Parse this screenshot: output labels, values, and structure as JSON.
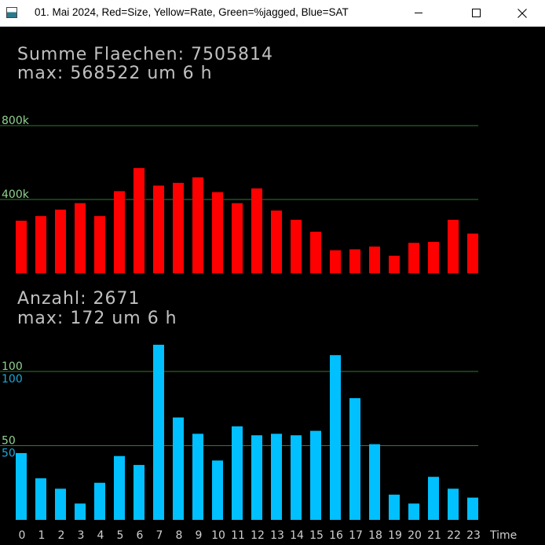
{
  "window": {
    "title": "01. Mai 2024, Red=Size, Yellow=Rate, Green=%jagged, Blue=SAT",
    "icon": "app-window-icon",
    "controls": [
      "minimize-icon",
      "maximize-icon",
      "close-icon"
    ]
  },
  "colors": {
    "red": "#ff0000",
    "blue": "#00c0ff",
    "grid": "#2e7d2e",
    "text": "#c0c0c0",
    "grid_label": "#8fd38f",
    "blue_label": "#1aa8d8"
  },
  "chart_data": [
    {
      "type": "bar",
      "header": [
        "Summe Flaechen: 7505814",
        "max: 568522 um 6 h"
      ],
      "gridlines": [
        {
          "value": 800000,
          "labels": [
            "800k"
          ]
        },
        {
          "value": 400000,
          "labels": [
            "400k"
          ]
        }
      ],
      "ylim": [
        0,
        800000
      ],
      "categories": [
        "0",
        "1",
        "2",
        "3",
        "4",
        "5",
        "6",
        "7",
        "8",
        "9",
        "10",
        "11",
        "12",
        "13",
        "14",
        "15",
        "16",
        "17",
        "18",
        "19",
        "20",
        "21",
        "22",
        "23"
      ],
      "values": [
        285000,
        310000,
        345000,
        380000,
        310000,
        445000,
        570000,
        475000,
        490000,
        520000,
        440000,
        380000,
        460000,
        340000,
        290000,
        225000,
        125000,
        130000,
        145000,
        95000,
        165000,
        170000,
        290000,
        215000
      ],
      "color": "#ff0000"
    },
    {
      "type": "bar",
      "header": [
        "Anzahl: 2671",
        "max: 172 um 6 h"
      ],
      "gridlines": [
        {
          "value": 100,
          "labels": [
            "100",
            "100"
          ]
        },
        {
          "value": 50,
          "labels": [
            "50",
            "50"
          ]
        }
      ],
      "ylim": [
        0,
        100
      ],
      "categories": [
        "0",
        "1",
        "2",
        "3",
        "4",
        "5",
        "6",
        "7",
        "8",
        "9",
        "10",
        "11",
        "12",
        "13",
        "14",
        "15",
        "16",
        "17",
        "18",
        "19",
        "20",
        "21",
        "22",
        "23"
      ],
      "values": [
        45,
        28,
        21,
        11,
        25,
        43,
        37,
        118,
        69,
        58,
        40,
        63,
        57,
        58,
        57,
        60,
        111,
        82,
        51,
        17,
        11,
        29,
        21,
        15
      ],
      "color": "#00c0ff",
      "xlabel": "Time"
    }
  ]
}
